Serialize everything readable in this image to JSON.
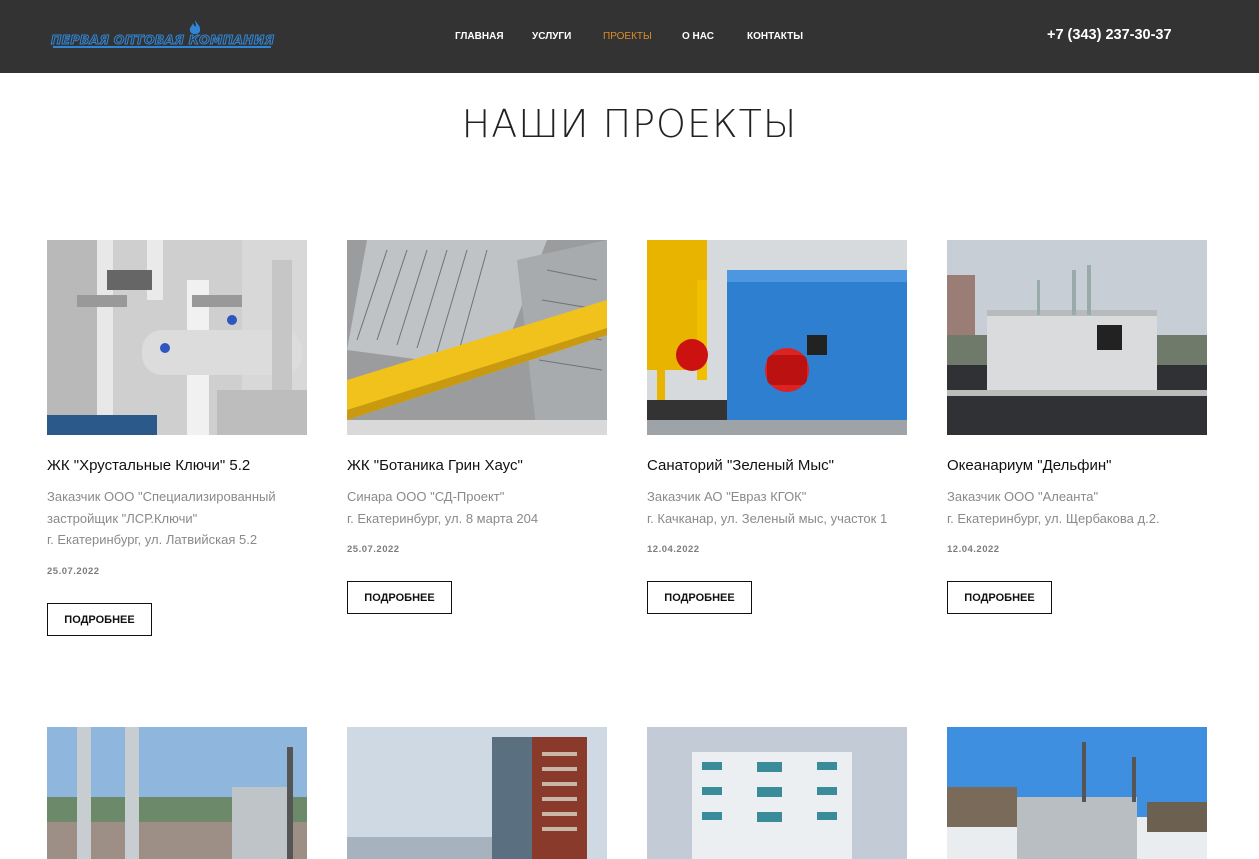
{
  "header": {
    "logo_text": "Первая оптовая компания",
    "nav": [
      {
        "label": "ГЛАВНАЯ",
        "active": false
      },
      {
        "label": "УСЛУГИ",
        "active": false
      },
      {
        "label": "ПРОЕКТЫ",
        "active": true
      },
      {
        "label": "О НАС",
        "active": false
      },
      {
        "label": "КОНТАКТЫ",
        "active": false
      }
    ],
    "phone": "+7 (343) 237-30-37"
  },
  "page_title": "НАШИ ПРОЕКТЫ",
  "projects": [
    {
      "title": "ЖК \"Хрустальные Ключи\" 5.2",
      "desc_lines": [
        "Заказчик ООО \"Специализированный",
        "застройщик \"ЛСР.Ключи\"",
        "г. Екатеринбург, ул. Латвийская 5.2"
      ],
      "date": "25.07.2022",
      "button": "ПОДРОБНЕЕ"
    },
    {
      "title": "ЖК \"Ботаника Грин Хаус\"",
      "desc_lines": [
        "Синара ООО \"СД-Проект\"",
        "г. Екатеринбург, ул. 8 марта 204"
      ],
      "date": "25.07.2022",
      "button": "ПОДРОБНЕЕ"
    },
    {
      "title": "Санаторий \"Зеленый Мыс\"",
      "desc_lines": [
        "Заказчик АО \"Евраз КГОК\"",
        "г. Качканар, ул. Зеленый мыс, участок 1"
      ],
      "date": "12.04.2022",
      "button": "ПОДРОБНЕЕ"
    },
    {
      "title": "Океанариум \"Дельфин\"",
      "desc_lines": [
        "Заказчик ООО \"Алеанта\"",
        "г. Екатеринбург, ул. Щербакова д.2."
      ],
      "date": "12.04.2022",
      "button": "ПОДРОБНЕЕ"
    }
  ],
  "colors": {
    "header_bg": "#333333",
    "nav_active": "#d98c2b",
    "logo_blue": "#2f86d6"
  }
}
